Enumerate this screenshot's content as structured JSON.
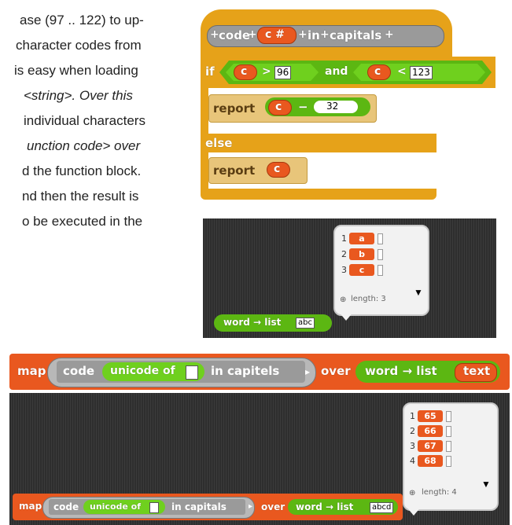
{
  "paragraph": {
    "lines": [
      "ase (97 .. 122) to up-",
      "character codes from",
      " is easy when loading",
      "<string>.  Over this",
      "individual characters",
      "unction code> over",
      "d the function block.",
      "nd then the result is",
      "o be executed in the"
    ]
  },
  "code_block": {
    "header": [
      "+",
      "code",
      "+",
      "c #",
      "+",
      "in",
      "+",
      "capitals",
      "+"
    ],
    "if_label": "if",
    "cond1_var": "c",
    "cond1_op": ">",
    "cond1_val": "96",
    "and_label": "and",
    "cond2_var": "c",
    "cond2_op": "<",
    "cond2_val": "123",
    "report1_label": "report",
    "report1_var": "c",
    "report1_op": "−",
    "report1_val": "32",
    "else_label": "else",
    "report2_label": "report",
    "report2_var": "c"
  },
  "word_list_demo": {
    "block_label": "word → list",
    "block_input": "abc",
    "items": [
      "a",
      "b",
      "c"
    ],
    "length_label": "length: 3"
  },
  "map_block_1": {
    "map_label": "map",
    "code_label": "code",
    "unicode_label": "unicode of",
    "in_label": "in capitels",
    "over_label": "over",
    "word_list_label": "word → list",
    "text_label": "text"
  },
  "map_block_2": {
    "map_label": "map",
    "code_label": "code",
    "unicode_label": "unicode of",
    "in_label": "in capitals",
    "over_label": "over",
    "word_list_label": "word → list",
    "input_value": "abcd",
    "items": [
      "65",
      "66",
      "67",
      "68"
    ],
    "length_label": "length: 4"
  },
  "colors": {
    "control": "#e6a219",
    "orange": "#e9581f",
    "green": "#5cb712",
    "report": "#e8c57a"
  }
}
